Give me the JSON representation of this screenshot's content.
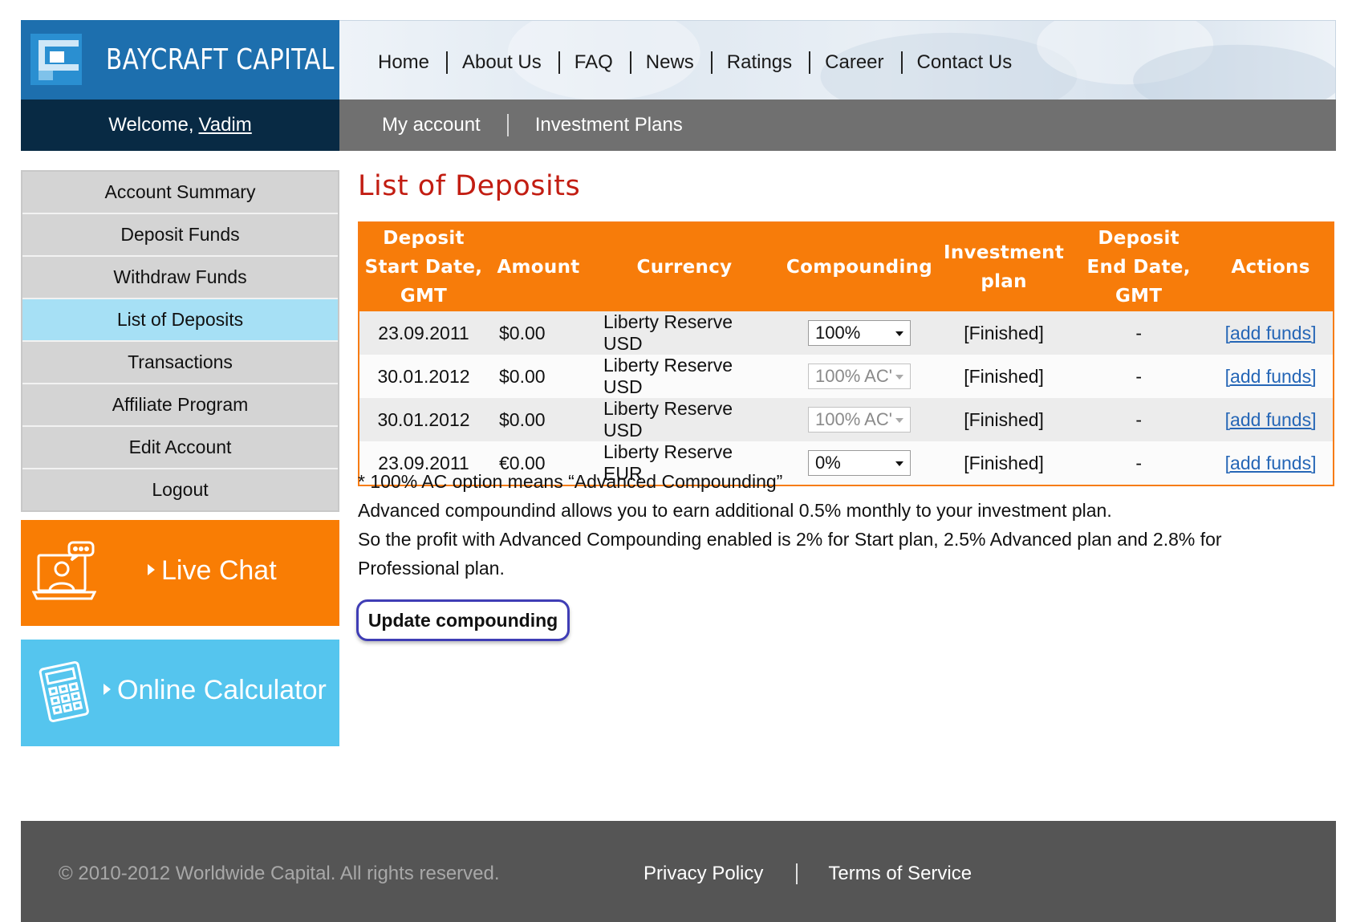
{
  "brand": {
    "name": "BAYCRAFT CAPITAL"
  },
  "topnav": {
    "items": [
      "Home",
      "About Us",
      "FAQ",
      "News",
      "Ratings",
      "Career",
      "Contact Us"
    ]
  },
  "welcome": {
    "prefix": "Welcome,",
    "username": "Vadim"
  },
  "subnav": {
    "items": [
      "My account",
      "Investment Plans"
    ]
  },
  "sidebar": {
    "items": [
      {
        "label": "Account Summary"
      },
      {
        "label": "Deposit Funds"
      },
      {
        "label": "Withdraw Funds"
      },
      {
        "label": "List of Deposits",
        "active": true
      },
      {
        "label": "Transactions"
      },
      {
        "label": "Affiliate Program"
      },
      {
        "label": "Edit Account"
      },
      {
        "label": "Logout"
      }
    ],
    "live_chat": {
      "label": "Live Chat",
      "icon": "live-chat-icon"
    },
    "calculator": {
      "label": "Online Calculator",
      "icon": "calculator-icon"
    }
  },
  "main": {
    "title": "List of Deposits",
    "table": {
      "headers": {
        "start_date": [
          "Deposit",
          "Start Date,",
          "GMT"
        ],
        "amount": "Amount",
        "currency": "Currency",
        "compounding": "Compounding",
        "plan": [
          "Investment",
          "plan"
        ],
        "end_date": [
          "Deposit",
          "End Date,",
          "GMT"
        ],
        "actions": "Actions"
      },
      "rows": [
        {
          "start_date": "23.09.2011",
          "amount": "$0.00",
          "currency": "Liberty Reserve USD",
          "compounding": "100%",
          "compounding_disabled": false,
          "plan": "[Finished]",
          "end_date": "-",
          "action": "[add funds]"
        },
        {
          "start_date": "30.01.2012",
          "amount": "$0.00",
          "currency": "Liberty Reserve USD",
          "compounding": "100% AC'",
          "compounding_disabled": true,
          "plan": "[Finished]",
          "end_date": "-",
          "action": "[add funds]"
        },
        {
          "start_date": "30.01.2012",
          "amount": "$0.00",
          "currency": "Liberty Reserve USD",
          "compounding": "100% AC'",
          "compounding_disabled": true,
          "plan": "[Finished]",
          "end_date": "-",
          "action": "[add funds]"
        },
        {
          "start_date": "23.09.2011",
          "amount": "€0.00",
          "currency": "Liberty Reserve EUR",
          "compounding": "0%",
          "compounding_disabled": false,
          "plan": "[Finished]",
          "end_date": "-",
          "action": "[add funds]"
        }
      ]
    },
    "notes": [
      "* 100% AC option means “Advanced Compounding”",
      "Advanced compoundind allows you to earn additional 0.5% monthly to your investment plan.",
      "So the profit with Advanced Compounding enabled is 2% for Start plan, 2.5% Advanced plan and 2.8% for Professional plan."
    ],
    "update_button": "Update compounding"
  },
  "footer": {
    "copyright": "© 2010-2012 Worldwide Capital. All rights reserved.",
    "links": [
      "Privacy Policy",
      "Terms of Service"
    ]
  },
  "colors": {
    "brand_blue": "#1d6fae",
    "welcome_navy": "#082a44",
    "subnav_gray": "#707070",
    "accent_orange": "#f77c0a",
    "active_menu": "#a6e0f5",
    "calculator_blue": "#55c5ee",
    "title_red": "#c21d12",
    "link_blue": "#2566b6"
  }
}
